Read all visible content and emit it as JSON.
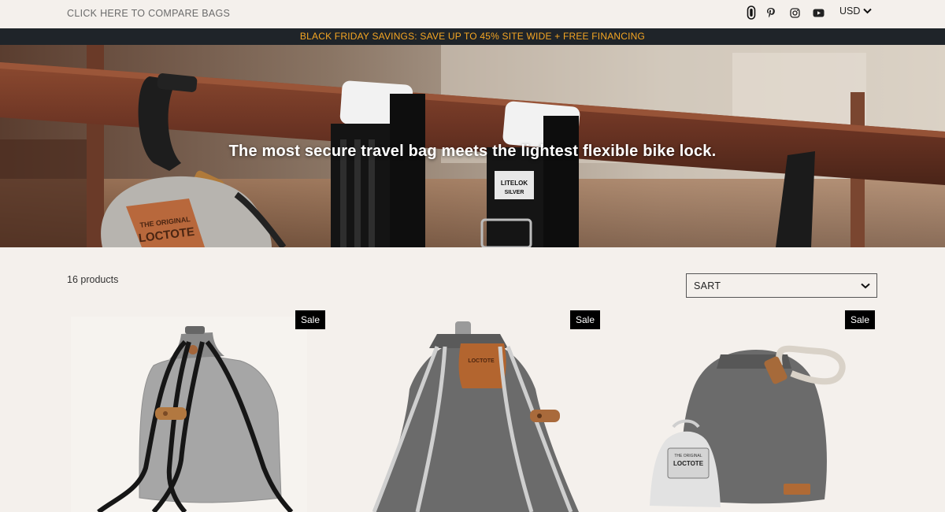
{
  "topbar": {
    "compare_link": "CLICK HERE TO COMPARE BAGS",
    "social_icons": [
      "grip-badge-icon",
      "pinterest-icon",
      "instagram-icon",
      "youtube-icon"
    ],
    "currency": "USD"
  },
  "announcement": {
    "text": "BLACK FRIDAY SAVINGS: SAVE UP TO 45% SITE WIDE + FREE FINANCING",
    "text_color": "#f5a623",
    "background": "#1f2429"
  },
  "hero": {
    "headline": "The most secure travel bag meets the lightest flexible bike lock.",
    "patch_text_line1": "THE ORIGINAL",
    "patch_text_line2": "LOCTOTE",
    "lock_label": "LITELOK",
    "lock_label_2": "SILVER"
  },
  "collection": {
    "product_count": "16 products",
    "sort_label": "SART"
  },
  "products": [
    {
      "badge": "Sale"
    },
    {
      "badge": "Sale",
      "patch_text": "LOCTOTE"
    },
    {
      "badge": "Sale",
      "patch_text": "LOCTOTE",
      "pouch_text": "THE ORIGINAL"
    }
  ],
  "colors": {
    "page_background": "#f4f0ec",
    "sale_badge": "#000000"
  }
}
